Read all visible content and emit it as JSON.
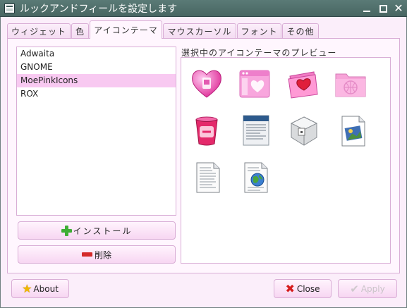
{
  "window": {
    "title": "ルックアンドフィールを設定します"
  },
  "tabs": [
    {
      "label": "ウィジェット"
    },
    {
      "label": "色"
    },
    {
      "label": "アイコンテーマ"
    },
    {
      "label": "マウスカーソル"
    },
    {
      "label": "フォント"
    },
    {
      "label": "その他"
    }
  ],
  "active_tab": "アイコンテーマ",
  "theme_list": {
    "items": [
      "Adwaita",
      "GNOME",
      "MoePinkIcons",
      "ROX"
    ],
    "selected": "MoePinkIcons"
  },
  "buttons": {
    "install": "インストール",
    "delete": "削除",
    "about": "About",
    "close": "Close",
    "apply": "Apply"
  },
  "preview": {
    "label": "選択中のアイコンテーマのプレビュー",
    "icons": [
      "heart-icon",
      "pink-window-icon",
      "heart-folder-icon",
      "network-folder-icon",
      "trash-icon",
      "document-icon",
      "package-icon",
      "image-file-icon",
      "text-file-icon",
      "html-file-icon"
    ]
  },
  "colors": {
    "titlebar": "#4f6e6a",
    "selection": "#f8c9f1",
    "border": "#d9aed6",
    "background": "#fbeefa"
  }
}
